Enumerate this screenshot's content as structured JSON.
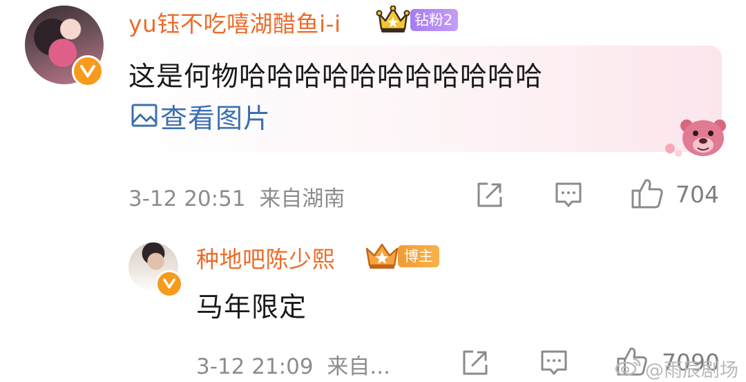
{
  "comment": {
    "username": "yu钰不吃嘻湖醋鱼i-i",
    "fan_badge": "钻粉2",
    "text": "这是何物哈哈哈哈哈哈哈哈哈哈哈",
    "view_image_label": "查看图片",
    "time": "3-12 20:51",
    "location": "来自湖南",
    "likes": "704",
    "accent_color": "#ec6b2a"
  },
  "reply": {
    "username": "种地吧陈少熙",
    "role_badge": "博主",
    "text": "马年限定",
    "time": "3-12 21:09",
    "location": "来自...",
    "likes": "7090"
  },
  "watermark": {
    "text": "@雨辰剧场",
    "icon": "weibo-logo-icon"
  },
  "icons": {
    "share": "share-icon",
    "comment": "comment-icon",
    "like": "thumbs-up-icon",
    "verified": "verified-v-icon",
    "image": "image-icon",
    "crown": "crown-icon",
    "sticker": "lotso-bear-sticker"
  }
}
